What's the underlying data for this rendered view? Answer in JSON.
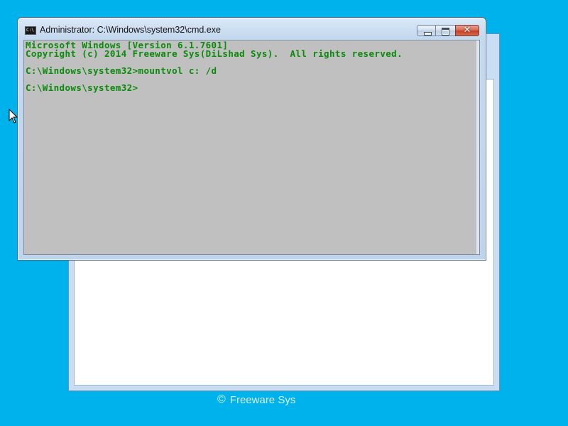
{
  "window": {
    "title": "Administrator: C:\\Windows\\system32\\cmd.exe",
    "icon": "cmd-icon",
    "icon_text": "C:\\",
    "minimize_icon": "minimize-icon",
    "maximize_icon": "maximize-icon",
    "close_icon": "close-icon",
    "close_glyph": "✕"
  },
  "console": {
    "text_color": "#0a8a0a",
    "background_color": "#c0c0c0",
    "lines": [
      "Microsoft Windows [Version 6.1.7601]",
      "Copyright (c) 2014 Freeware Sys(DiLshad Sys).  All rights reserved.",
      "",
      "C:\\Windows\\system32>mountvol c: /d",
      "",
      "C:\\Windows\\system32>"
    ]
  },
  "footer": {
    "copyright_symbol": "©",
    "brand": "Freeware Sys"
  },
  "desktop": {
    "background_color": "#00b2ec"
  }
}
